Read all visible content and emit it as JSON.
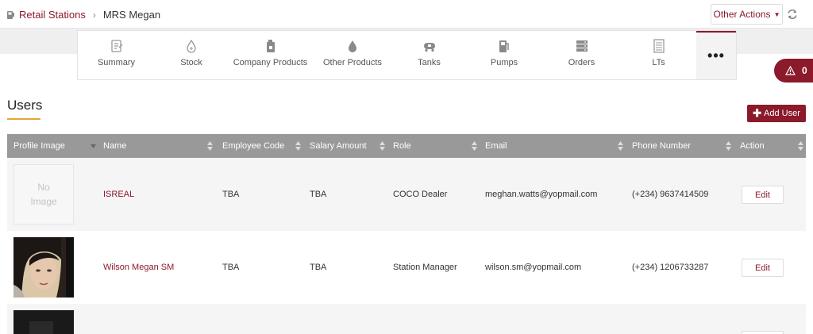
{
  "breadcrumb": {
    "parent": "Retail Stations",
    "current": "MRS Megan"
  },
  "header": {
    "other_actions_label": "Other Actions"
  },
  "tabs": [
    {
      "label": "Summary",
      "icon": "summary-icon"
    },
    {
      "label": "Stock",
      "icon": "stock-icon"
    },
    {
      "label": "Company Products",
      "icon": "company-products-icon"
    },
    {
      "label": "Other Products",
      "icon": "other-products-icon"
    },
    {
      "label": "Tanks",
      "icon": "tanks-icon"
    },
    {
      "label": "Pumps",
      "icon": "pumps-icon"
    },
    {
      "label": "Orders",
      "icon": "orders-icon"
    },
    {
      "label": "LTs",
      "icon": "lts-icon"
    }
  ],
  "more_tab_label": "•••",
  "alerts": {
    "count": "0"
  },
  "users": {
    "title": "Users",
    "add_label": "Add User",
    "columns": [
      "Profile Image",
      "Name",
      "Employee Code",
      "Salary Amount",
      "Role",
      "Email",
      "Phone Number",
      "Action"
    ],
    "no_image_text": "No Image",
    "rows": [
      {
        "name": "ISREAL",
        "employee_code": "TBA",
        "salary": "TBA",
        "role": "COCO Dealer",
        "email": "meghan.watts@yopmail.com",
        "phone": "(+234) 9637414509",
        "action": "Edit"
      },
      {
        "name": "Wilson Megan SM",
        "employee_code": "TBA",
        "salary": "TBA",
        "role": "Station Manager",
        "email": "wilson.sm@yopmail.com",
        "phone": "(+234) 1206733287",
        "action": "Edit"
      }
    ]
  },
  "colors": {
    "brand": "#8b1a2b",
    "accent_underline": "#e8a33c",
    "table_header": "#999999"
  }
}
